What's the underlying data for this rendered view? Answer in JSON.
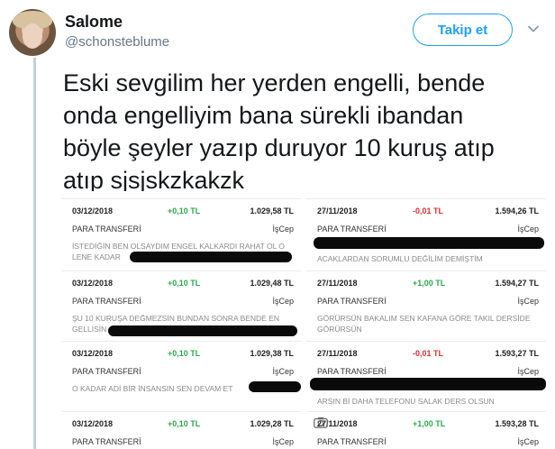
{
  "user": {
    "name": "Salome",
    "handle": "@schonsteblume"
  },
  "follow_button": "Takip et",
  "tweet": {
    "lines": [
      "Eski sevgilim her yerden engelli, bende",
      "onda engelliyim bana sürekli ibandan",
      "böyle şeyler yazıp duruyor 10 kuruş atıp",
      "atıp sjsjskzkakzk"
    ]
  },
  "transactions": {
    "left": [
      {
        "date": "03/12/2018",
        "change": "+0,10 TL",
        "balance": "1.029,58 TL",
        "type": "PARA TRANSFERİ",
        "channel": "İşCep",
        "desc": "İSTEDİĞİN BEN OLSAYDIM ENGEL KALKARDI RAHAT OL O LENE KADAR",
        "sign": "pos"
      },
      {
        "date": "03/12/2018",
        "change": "+0,10 TL",
        "balance": "1.029,48 TL",
        "type": "PARA TRANSFERİ",
        "channel": "İşCep",
        "desc": "ŞU 10 KURUŞA DEĞMEZSİN BUNDAN SONRA BENDE EN GELLİSİN",
        "sign": "pos"
      },
      {
        "date": "03/12/2018",
        "change": "+0,10 TL",
        "balance": "1.029,38 TL",
        "type": "PARA TRANSFERİ",
        "channel": "İşCep",
        "desc": "O KADAR ADİ BİR İNSANSIN SEN DEVAM ET",
        "sign": "pos"
      },
      {
        "date": "03/12/2018",
        "change": "+0,10 TL",
        "balance": "1.029,28 TL",
        "type": "PARA TRANSFERİ",
        "channel": "İşCep",
        "desc": "",
        "sign": "pos"
      }
    ],
    "right": [
      {
        "date": "27/11/2018",
        "change": "-0,01 TL",
        "balance": "1.594,26 TL",
        "type": "PARA TRANSFERİ",
        "channel": "İşCep",
        "desc": "ACAKLARDAN SORUMLU DEĞİLİM DEMİŞTİM",
        "sign": "neg"
      },
      {
        "date": "27/11/2018",
        "change": "+1,00 TL",
        "balance": "1.594,27 TL",
        "type": "PARA TRANSFERİ",
        "channel": "İşCep",
        "desc": "GÖRÜRSÜN BAKALIM SEN KAFANA GÖRE TAKIL DERSİDE GÖRÜRSÜN",
        "sign": "pos"
      },
      {
        "date": "27/11/2018",
        "change": "-0,01 TL",
        "balance": "1.593,27 TL",
        "type": "PARA TRANSFERİ",
        "channel": "İşCep",
        "desc": "ARSIN Bİ DAHA TELEFONU SALAK DERS OLSUN",
        "sign": "neg"
      },
      {
        "date": "27/11/2018",
        "change": "+1,00 TL",
        "balance": "1.593,28 TL",
        "type": "PARA TRANSFERİ",
        "channel": "İşCep",
        "desc": "",
        "sign": "pos"
      }
    ]
  },
  "colors": {
    "accent": "#1da1f2",
    "positive": "#2aa84a",
    "negative": "#d93030",
    "thread_line": "#c4cfd6"
  },
  "icons": [
    "chevron-down-icon",
    "camera-icon"
  ]
}
